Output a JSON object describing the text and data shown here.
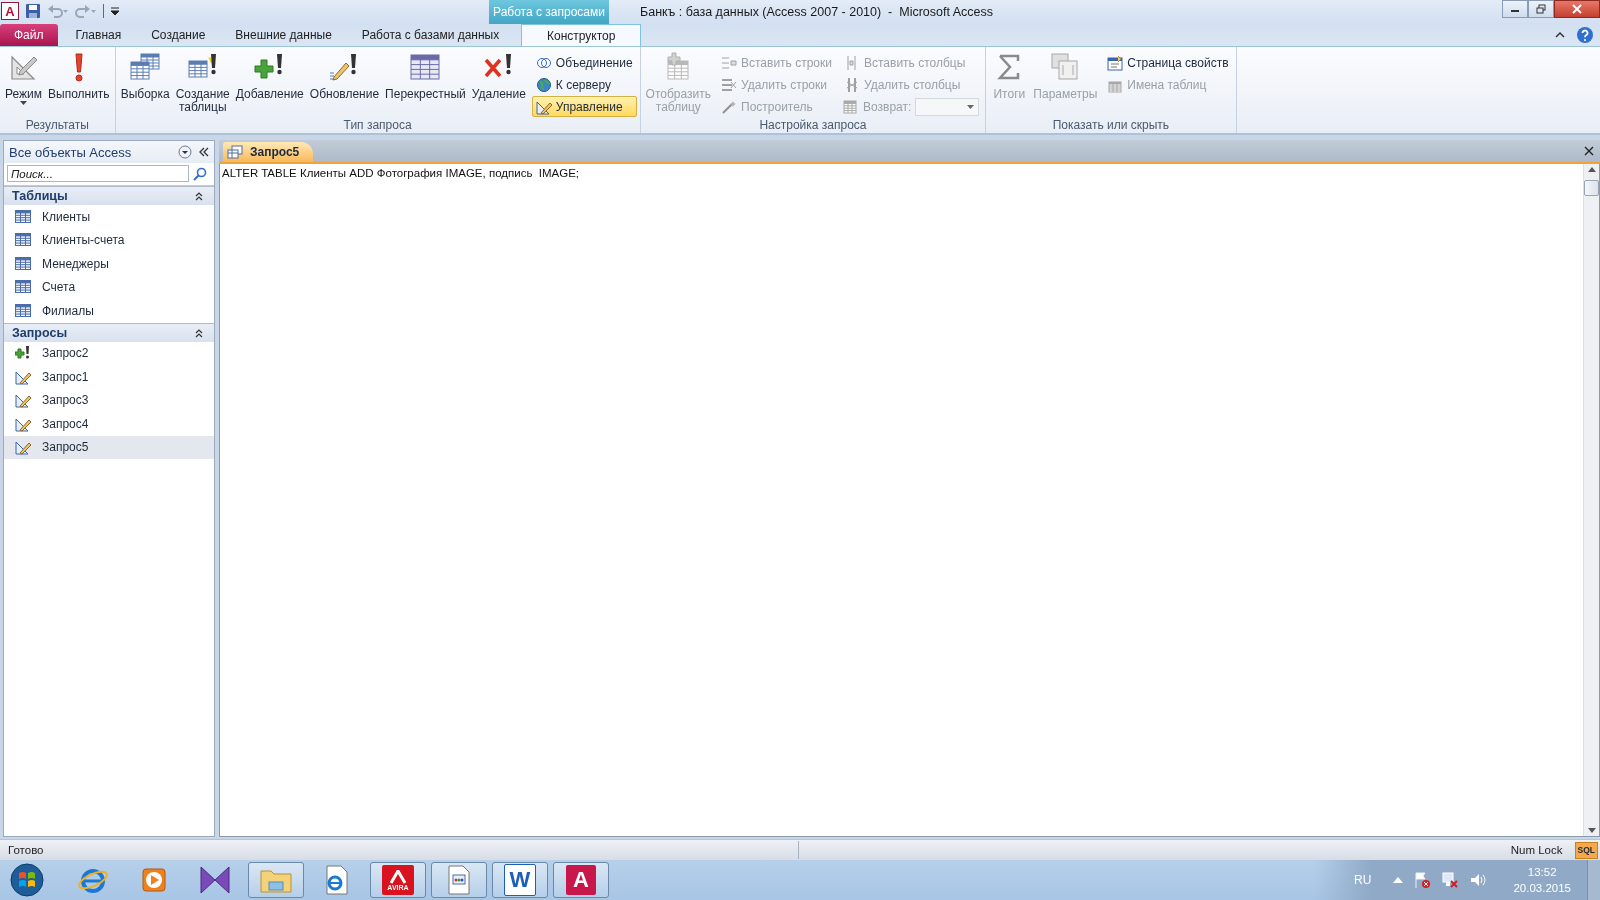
{
  "title_bar": {
    "app_glyph": "A",
    "contextual_tab": "Работа с запросами",
    "title": "Банкъ : база данных (Access 2007 - 2010)  -  Microsoft Access"
  },
  "ribbon_tabs": [
    {
      "label": "Файл",
      "kind": "file",
      "selected": false
    },
    {
      "label": "Главная",
      "kind": "tab",
      "selected": false
    },
    {
      "label": "Создание",
      "kind": "tab",
      "selected": false
    },
    {
      "label": "Внешние данные",
      "kind": "tab",
      "selected": false
    },
    {
      "label": "Работа с базами данных",
      "kind": "tab",
      "selected": false
    },
    {
      "label": "Конструктор",
      "kind": "contextual",
      "selected": true
    }
  ],
  "ribbon_groups": [
    {
      "label": "Результаты",
      "items": [
        {
          "kind": "large",
          "label": "Режим",
          "dropdown": true,
          "disabled": false,
          "selected": false
        },
        {
          "kind": "large",
          "label": "Выполнить",
          "dropdown": false,
          "disabled": false,
          "selected": false
        }
      ]
    },
    {
      "label": "Тип запроса",
      "items": [
        {
          "kind": "large",
          "label": "Выборка",
          "dropdown": false,
          "disabled": false,
          "selected": false
        },
        {
          "kind": "large",
          "label": "Создание\nтаблицы",
          "dropdown": false,
          "disabled": false,
          "selected": false
        },
        {
          "kind": "large",
          "label": "Добавление",
          "dropdown": false,
          "disabled": false,
          "selected": false
        },
        {
          "kind": "large",
          "label": "Обновление",
          "dropdown": false,
          "disabled": false,
          "selected": false
        },
        {
          "kind": "large",
          "label": "Перекрестный",
          "dropdown": false,
          "disabled": false,
          "selected": false
        },
        {
          "kind": "large",
          "label": "Удаление",
          "dropdown": false,
          "disabled": false,
          "selected": false
        },
        {
          "kind": "small",
          "label": "Объединение",
          "dropdown": false,
          "disabled": false,
          "selected": false
        },
        {
          "kind": "small",
          "label": "К серверу",
          "dropdown": false,
          "disabled": false,
          "selected": false
        },
        {
          "kind": "small",
          "label": "Управление",
          "dropdown": false,
          "disabled": false,
          "selected": true
        }
      ]
    },
    {
      "label": "Настройка запроса",
      "items": [
        {
          "kind": "large",
          "label": "Отобразить\nтаблицу",
          "dropdown": false,
          "disabled": true,
          "selected": false
        },
        {
          "kind": "small",
          "label": "Вставить строки",
          "dropdown": false,
          "disabled": true,
          "selected": false
        },
        {
          "kind": "small",
          "label": "Удалить строки",
          "dropdown": false,
          "disabled": true,
          "selected": false
        },
        {
          "kind": "small",
          "label": "Построитель",
          "dropdown": false,
          "disabled": true,
          "selected": false
        },
        {
          "kind": "small",
          "label": "Вставить столбцы",
          "dropdown": false,
          "disabled": true,
          "selected": false
        },
        {
          "kind": "small",
          "label": "Удалить столбцы",
          "dropdown": false,
          "disabled": true,
          "selected": false
        },
        {
          "kind": "combo",
          "label": "Возврат:",
          "dropdown": true,
          "disabled": true,
          "selected": false
        }
      ]
    },
    {
      "label": "Показать или скрыть",
      "items": [
        {
          "kind": "large",
          "label": "Итоги",
          "dropdown": false,
          "disabled": true,
          "selected": false
        },
        {
          "kind": "large",
          "label": "Параметры",
          "dropdown": false,
          "disabled": true,
          "selected": false
        },
        {
          "kind": "small",
          "label": "Страница свойств",
          "dropdown": false,
          "disabled": false,
          "selected": false
        },
        {
          "kind": "small",
          "label": "Имена таблиц",
          "dropdown": false,
          "disabled": true,
          "selected": false
        }
      ]
    }
  ],
  "nav_pane": {
    "header": "Все объекты Access",
    "search": {
      "placeholder": "Поиск..."
    },
    "sections": [
      {
        "title": "Таблицы",
        "expanded": true,
        "items": [
          {
            "label": "Клиенты",
            "kind": "table",
            "selected": false
          },
          {
            "label": "Клиенты-счета",
            "kind": "table",
            "selected": false
          },
          {
            "label": "Менеджеры",
            "kind": "table",
            "selected": false
          },
          {
            "label": "Счета",
            "kind": "table",
            "selected": false
          },
          {
            "label": "Филиалы",
            "kind": "table",
            "selected": false
          }
        ]
      },
      {
        "title": "Запросы",
        "expanded": true,
        "items": [
          {
            "label": "Запрос2",
            "kind": "append",
            "selected": false
          },
          {
            "label": "Запрос1",
            "kind": "ddl",
            "selected": false
          },
          {
            "label": "Запрос3",
            "kind": "ddl",
            "selected": false
          },
          {
            "label": "Запрос4",
            "kind": "ddl",
            "selected": false
          },
          {
            "label": "Запрос5",
            "kind": "ddl",
            "selected": true
          }
        ]
      }
    ]
  },
  "document": {
    "tabs": [
      {
        "label": "Запрос5",
        "selected": true
      }
    ],
    "sql": "ALTER TABLE Клиенты ADD Фотография IMAGE, подпись  IMAGE;"
  },
  "status_bar": {
    "status": "Готово",
    "indicator": "Num Lock",
    "view_buttons": [
      {
        "label": "SQL",
        "selected": true
      }
    ]
  },
  "taskbar": {
    "apps": [
      {
        "kind": "ie",
        "running": false
      },
      {
        "kind": "media",
        "running": false
      },
      {
        "kind": "bowtie",
        "running": false
      },
      {
        "kind": "folder",
        "running": true
      },
      {
        "kind": "iedoc",
        "running": false
      },
      {
        "kind": "avira",
        "label": "AVIRA",
        "running": true
      },
      {
        "kind": "doc",
        "running": true
      },
      {
        "kind": "word",
        "label": "W",
        "running": true
      },
      {
        "kind": "access",
        "label": "A",
        "running": true
      }
    ],
    "language": "RU",
    "time": "13:52",
    "date": "20.03.2015"
  }
}
